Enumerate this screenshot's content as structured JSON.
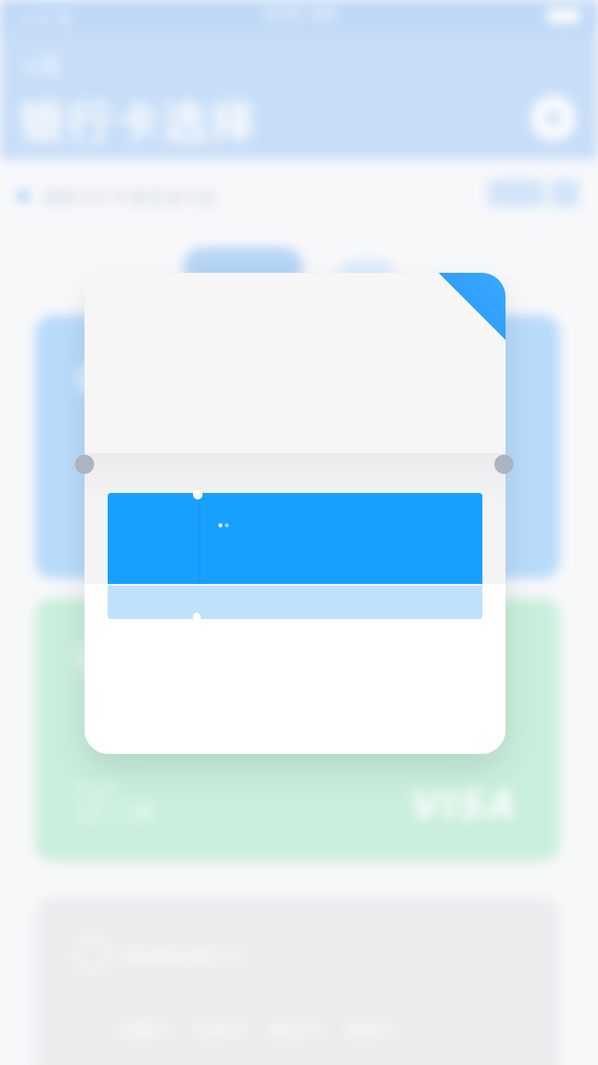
{
  "colors": {
    "accent": "#18a0ff",
    "nav_bg": "#b6d4f8",
    "blue_card": "#9fd0fb",
    "green_card": "#b7ecd0",
    "gray_card": "#e8e8eb",
    "modal_top": "#f6f6f7"
  },
  "status_bar": {
    "carrier": "••ll 令",
    "time": "9:41 AM",
    "battery_icon": "battery-icon"
  },
  "nav": {
    "back_label": "<返",
    "title": "银行卡选择",
    "add_icon": "plus-icon",
    "add_symbol": "+"
  },
  "hint": {
    "text": "请将卡片平放至读卡区"
  },
  "background_cards": {
    "green": {
      "expiry_label": "有效期",
      "expiry": "12 / 18",
      "brand": "VISA"
    },
    "gray": {
      "title": "添加新的银行卡",
      "tags": [
        "储蓄卡",
        "信用卡",
        "借记卡",
        "其他卡"
      ]
    }
  },
  "modal": {
    "loading": {
      "state": "loading",
      "dots_icon": "loading-dots-icon"
    }
  }
}
